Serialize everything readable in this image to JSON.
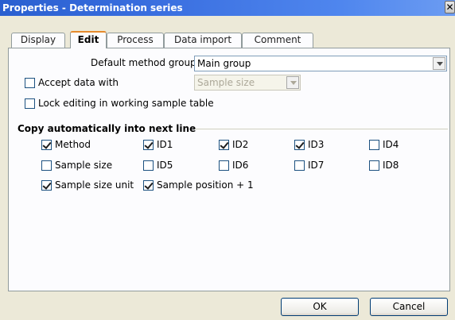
{
  "window": {
    "title": "Properties - Determination series",
    "close_symbol": "✕"
  },
  "tabs": [
    {
      "label": "Display"
    },
    {
      "label": "Edit"
    },
    {
      "label": "Process"
    },
    {
      "label": "Data import"
    },
    {
      "label": "Comment"
    }
  ],
  "active_tab": "Edit",
  "edit": {
    "default_method_group": {
      "label": "Default method group",
      "value": "Main group"
    },
    "accept_data_with": {
      "label": "Accept data with",
      "checked": false,
      "value": "Sample size",
      "enabled": false
    },
    "lock_editing": {
      "label": "Lock editing in working sample table",
      "checked": false
    }
  },
  "copy_section": {
    "title": "Copy automatically into next line",
    "items": [
      {
        "label": "Method",
        "checked": true
      },
      {
        "label": "ID1",
        "checked": true
      },
      {
        "label": "ID2",
        "checked": true
      },
      {
        "label": "ID3",
        "checked": true
      },
      {
        "label": "ID4",
        "checked": false
      },
      {
        "label": "Sample size",
        "checked": false
      },
      {
        "label": "ID5",
        "checked": false
      },
      {
        "label": "ID6",
        "checked": false
      },
      {
        "label": "ID7",
        "checked": false
      },
      {
        "label": "ID8",
        "checked": false
      },
      {
        "label": "Sample size unit",
        "checked": true
      },
      {
        "label": "Sample position + 1",
        "checked": true
      }
    ]
  },
  "buttons": {
    "ok": "OK",
    "cancel": "Cancel"
  },
  "colors": {
    "titlebar": "#2a5fd0",
    "active_tab_accent": "#e68b2c",
    "dialog_bg": "#ece9d8"
  }
}
